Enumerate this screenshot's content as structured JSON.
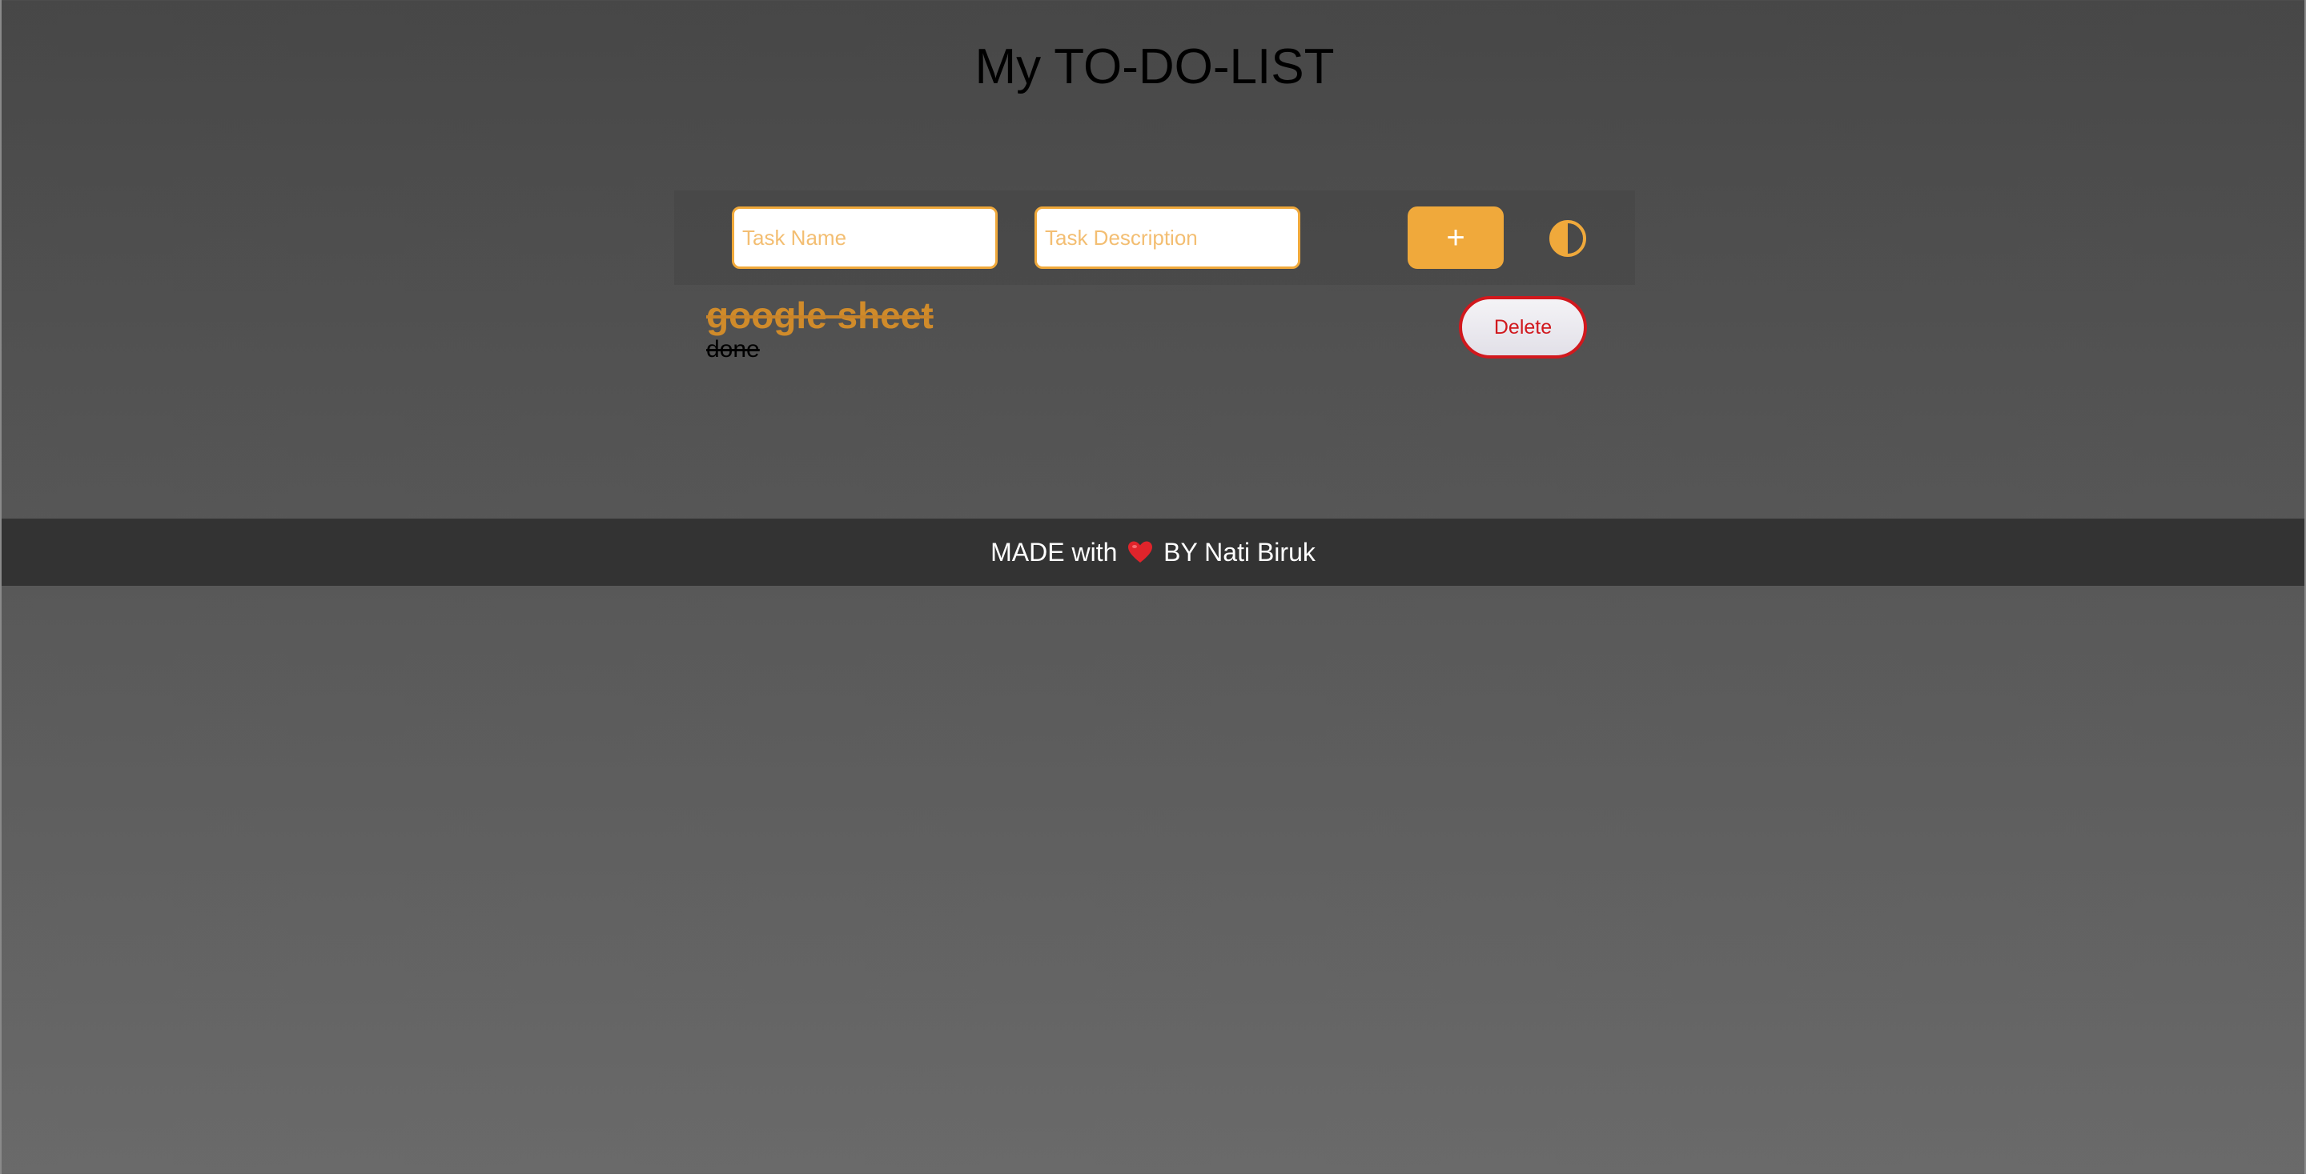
{
  "header": {
    "title": "My TO-DO-LIST"
  },
  "form": {
    "task_name_placeholder": "Task Name",
    "task_description_placeholder": "Task Description",
    "add_button_label": "+",
    "theme_toggle_icon": "contrast-icon"
  },
  "tasks": [
    {
      "name": "google sheet",
      "description": "done",
      "completed": true,
      "delete_label": "Delete"
    }
  ],
  "footer": {
    "prefix": "MADE with",
    "heart_icon": "heart-icon",
    "suffix": "BY Nati Biruk"
  },
  "colors": {
    "accent": "#f0a93b",
    "delete": "#d1181d",
    "footer_bg": "#333333"
  }
}
